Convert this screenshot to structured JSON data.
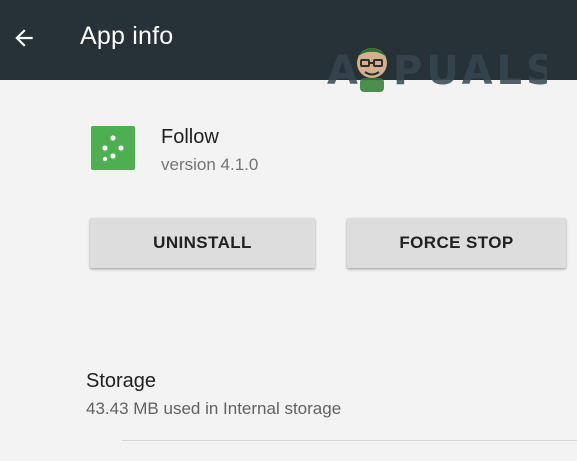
{
  "toolbar": {
    "title": "App info",
    "back_icon": "arrow-back-icon",
    "background_color": "#263238"
  },
  "watermark": {
    "text": "A PUALS"
  },
  "app": {
    "icon": "follow-app-icon",
    "icon_color": "#4caf50",
    "name": "Follow",
    "version": "version 4.1.0"
  },
  "actions": {
    "uninstall_label": "UNINSTALL",
    "force_stop_label": "FORCE STOP"
  },
  "storage": {
    "title": "Storage",
    "summary": "43.43 MB used in Internal storage"
  }
}
